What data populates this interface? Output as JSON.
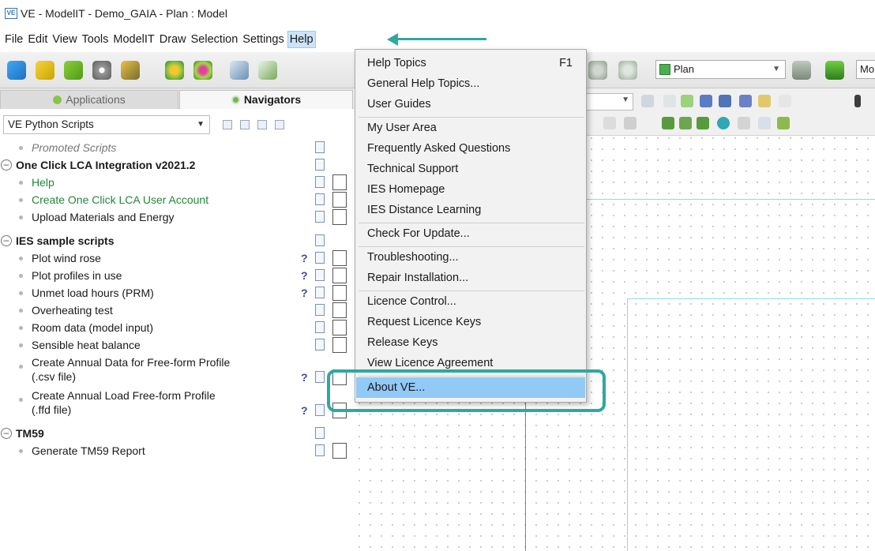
{
  "window": {
    "title": "VE - ModelIT - Demo_GAIA - Plan : Model",
    "icon_text": "VE"
  },
  "menubar": {
    "items": [
      "File",
      "Edit",
      "View",
      "Tools",
      "ModelIT",
      "Draw",
      "Selection",
      "Settings",
      "Help"
    ],
    "active_index": 8
  },
  "toolbar": {
    "view_select": "Plan",
    "mode_select": "Mo"
  },
  "left_panel": {
    "tabs": [
      {
        "label": "Applications"
      },
      {
        "label": "Navigators"
      }
    ],
    "script_selector": "VE Python Scripts",
    "tree": {
      "promoted": "Promoted Scripts",
      "groups": [
        {
          "name": "One Click LCA Integration v2021.2",
          "items": [
            "Help",
            "Create One Click LCA User Account",
            "Upload Materials and Energy"
          ]
        },
        {
          "name": "IES sample scripts",
          "items": [
            "Plot wind rose",
            "Plot profiles in use",
            "Unmet load hours (PRM)",
            "Overheating test",
            "Room data (model input)",
            "Sensible heat balance",
            "Create Annual Data for Free-form Profile",
            "(.csv file)",
            "Create Annual Load Free-form Profile",
            "(.ffd file)"
          ]
        },
        {
          "name": "TM59",
          "items": [
            "Generate TM59 Report"
          ]
        }
      ],
      "help_marker": "?"
    }
  },
  "help_menu": {
    "items": [
      {
        "label": "Help Topics",
        "shortcut": "F1"
      },
      {
        "label": "General Help Topics..."
      },
      {
        "label": "User Guides"
      },
      {
        "label": "My User Area"
      },
      {
        "label": "Frequently Asked Questions"
      },
      {
        "label": "Technical Support"
      },
      {
        "label": "IES Homepage"
      },
      {
        "label": "IES Distance Learning"
      },
      {
        "label": "Check For Update..."
      },
      {
        "label": "Troubleshooting..."
      },
      {
        "label": "Repair Installation..."
      },
      {
        "label": "Licence Control..."
      },
      {
        "label": "Request Licence Keys"
      },
      {
        "label": "Release Keys"
      },
      {
        "label": "View Licence Agreement"
      },
      {
        "label": "About VE..."
      }
    ],
    "highlighted_index": 15
  },
  "colors": {
    "annotation": "#2fa8a0",
    "menu_highlight": "#91c9f7",
    "green_link": "#22863a"
  }
}
